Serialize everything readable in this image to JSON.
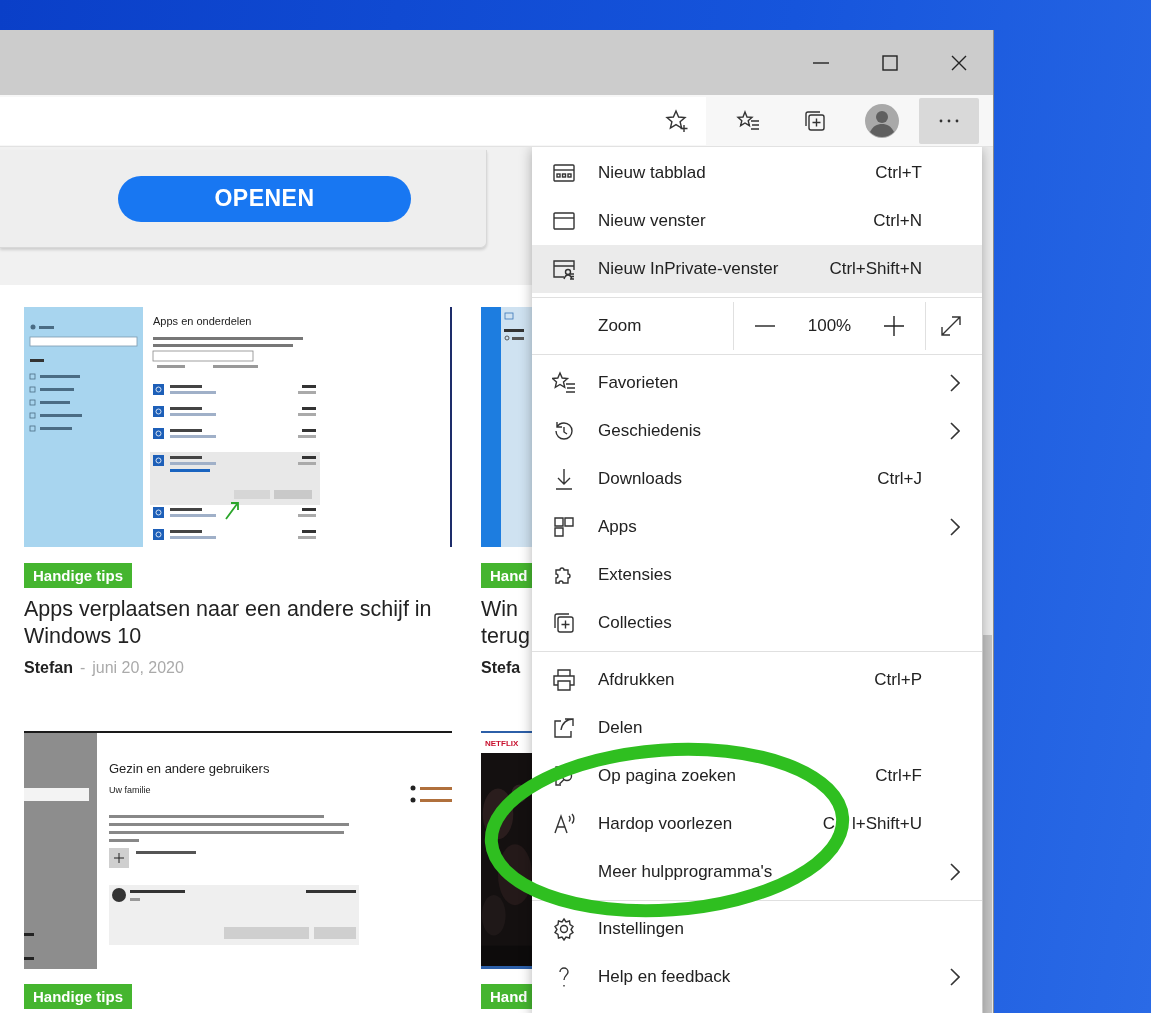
{
  "toolbar": {
    "more_button": {
      "selected": true
    }
  },
  "page": {
    "promo": {
      "button": "OPENEN"
    },
    "articles": [
      {
        "tag": "Handige tips",
        "title": "Apps verplaatsen naar een andere schijf in Windows 10",
        "author": "Stefan",
        "separator": "-",
        "date": "juni 20, 2020",
        "thumbnail": {
          "kind": "apps",
          "title": "Apps en onderdelen"
        }
      },
      {
        "tag": "Hand",
        "title_lines": [
          "Win",
          "terug"
        ],
        "author": "Stefa",
        "thumbnail": {
          "kind": "search"
        }
      },
      {
        "tag": "Handige tips",
        "thumbnail": {
          "kind": "family",
          "title": "Gezin en andere gebruikers",
          "subtitle": "Uw familie"
        }
      },
      {
        "tag": "Hand",
        "thumbnail": {
          "kind": "video",
          "brand": "NETFLIX"
        }
      }
    ]
  },
  "menu": {
    "items": [
      {
        "kind": "item",
        "label": "Nieuw tabblad",
        "shortcut": [
          "Ctrl+T"
        ],
        "submenu": false,
        "highlighted": false
      },
      {
        "kind": "item",
        "label": "Nieuw venster",
        "shortcut": [
          "Ctrl+N"
        ],
        "submenu": false,
        "highlighted": false
      },
      {
        "kind": "item",
        "label": "Nieuw InPrivate-venster",
        "shortcut": [
          "Ctrl+Shift+N"
        ],
        "submenu": false,
        "highlighted": true
      },
      {
        "kind": "separator"
      },
      {
        "kind": "zoom",
        "label": "Zoom",
        "value": "100%"
      },
      {
        "kind": "separator"
      },
      {
        "kind": "item",
        "label": "Favorieten",
        "submenu": true,
        "highlighted": false
      },
      {
        "kind": "item",
        "label": "Geschiedenis",
        "submenu": true,
        "highlighted": false
      },
      {
        "kind": "item",
        "label": "Downloads",
        "shortcut": [
          "Ctrl+J"
        ],
        "submenu": false,
        "highlighted": false
      },
      {
        "kind": "item",
        "label": "Apps",
        "submenu": true,
        "highlighted": false
      },
      {
        "kind": "item",
        "label": "Extensies",
        "submenu": false,
        "highlighted": false
      },
      {
        "kind": "item",
        "label": "Collecties",
        "submenu": false,
        "highlighted": false
      },
      {
        "kind": "separator"
      },
      {
        "kind": "item",
        "label": "Afdrukken",
        "shortcut": [
          "Ctrl+P"
        ],
        "submenu": false,
        "highlighted": false
      },
      {
        "kind": "item",
        "label": "Delen",
        "submenu": false,
        "highlighted": false
      },
      {
        "kind": "item",
        "label": "Op pagina zoeken",
        "shortcut": [
          "Ctrl+F"
        ],
        "submenu": false,
        "highlighted": false
      },
      {
        "kind": "item",
        "label": "Hardop voorlezen",
        "shortcut": [
          "C",
          "l+Shift+U"
        ],
        "submenu": false,
        "highlighted": false
      },
      {
        "kind": "item",
        "label": "Meer hulpprogramma's",
        "submenu": true,
        "highlighted": false
      },
      {
        "kind": "separator"
      },
      {
        "kind": "item",
        "label": "Instellingen",
        "submenu": false,
        "highlighted": false
      },
      {
        "kind": "item",
        "label": "Help en feedback",
        "submenu": true,
        "highlighted": false
      }
    ]
  }
}
